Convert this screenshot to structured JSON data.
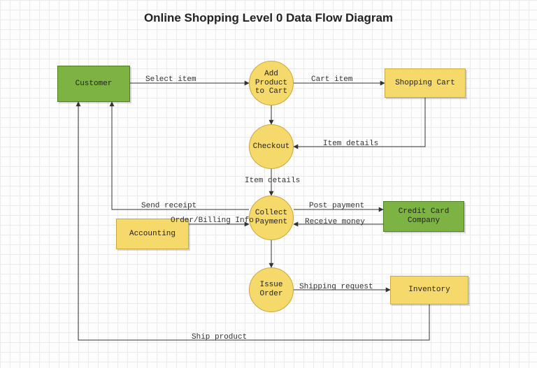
{
  "title": "Online Shopping Level 0 Data Flow Diagram",
  "entities": {
    "customer": "Customer",
    "shopping_cart": "Shopping Cart",
    "accounting": "Accounting",
    "credit_card_company": "Credit Card\nCompany",
    "inventory": "Inventory"
  },
  "processes": {
    "add_product": "Add\nProduct\nto Cart",
    "checkout": "Checkout",
    "collect_payment": "Collect\nPayment",
    "issue_order": "Issue\nOrder"
  },
  "flows": {
    "select_item": "Select item",
    "cart_item": "Cart item",
    "item_details_cart": "Item details",
    "item_details_checkout": "Item details",
    "send_receipt": "Send receipt",
    "order_billing_info": "Order/Billing Info",
    "post_payment": "Post payment",
    "receive_money": "Receive money",
    "shipping_request": "Shipping request",
    "ship_product": "Ship product"
  }
}
